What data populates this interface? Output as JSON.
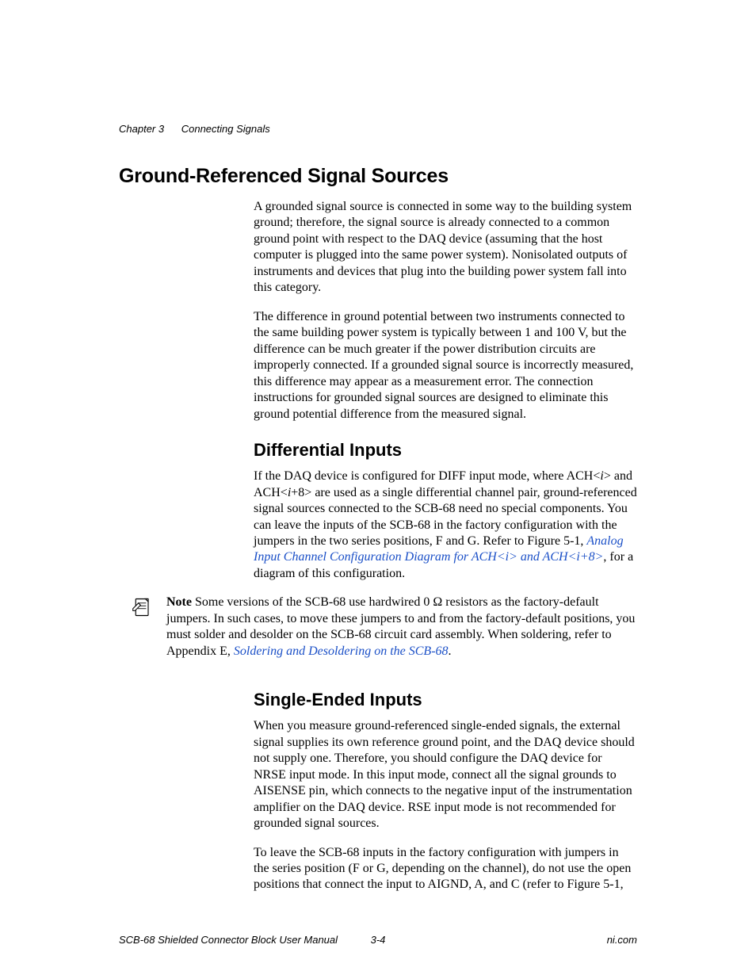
{
  "header": {
    "chapter": "Chapter 3",
    "title": "Connecting Signals"
  },
  "section1": {
    "heading": "Ground-Referenced Signal Sources",
    "p1": "A grounded signal source is connected in some way to the building system ground; therefore, the signal source is already connected to a common ground point with respect to the DAQ device (assuming that the host computer is plugged into the same power system). Nonisolated outputs of instruments and devices that plug into the building power system fall into this category.",
    "p2": "The difference in ground potential between two instruments connected to the same building power system is typically between 1 and 100 V, but the difference can be much greater if the power distribution circuits are improperly connected. If a grounded signal source is incorrectly measured, this difference may appear as a measurement error. The connection instructions for grounded signal sources are designed to eliminate this ground potential difference from the measured signal."
  },
  "sub1": {
    "heading": "Differential Inputs",
    "p1a": "If the DAQ device is configured for DIFF input mode, where ACH<",
    "p1i1": "i",
    "p1b": "> and ACH<",
    "p1i2": "i",
    "p1c": "+8> are used as a single differential channel pair, ground-referenced signal sources connected to the SCB-68 need no special components. You can leave the inputs of the SCB-68 in the factory configuration with the jumpers in the two series positions, F and G. Refer to Figure 5-1, ",
    "p1link": "Analog Input Channel Configuration Diagram for ACH<i> and ACH<i+8>",
    "p1d": ", for a diagram of this configuration."
  },
  "note": {
    "label": "Note",
    "text1": "   Some versions of the SCB-68 use hardwired 0 Ω resistors as the factory-default jumpers. In such cases, to move these jumpers to and from the factory-default positions, you must solder and desolder on the SCB-68 circuit card assembly. When soldering, refer to Appendix E, ",
    "link": "Soldering and Desoldering on the SCB-68",
    "text2": "."
  },
  "sub2": {
    "heading": "Single-Ended Inputs",
    "p1": "When you measure ground-referenced single-ended signals, the external signal supplies its own reference ground point, and the DAQ device should not supply one. Therefore, you should configure the DAQ device for NRSE input mode. In this input mode, connect all the signal grounds to AISENSE pin, which connects to the negative input of the instrumentation amplifier on the DAQ device. RSE input mode is not recommended for grounded signal sources.",
    "p2a": "To leave the SCB-68 inputs in the factory configuration with jumpers in the series position (F or G",
    "p2i": ",",
    "p2b": " depending on the channel), do not use the open positions that connect the input to AIGND, A, and C (refer to Figure 5-1,"
  },
  "footer": {
    "left": "SCB-68 Shielded Connector Block User Manual",
    "center": "3-4",
    "right": "ni.com"
  }
}
